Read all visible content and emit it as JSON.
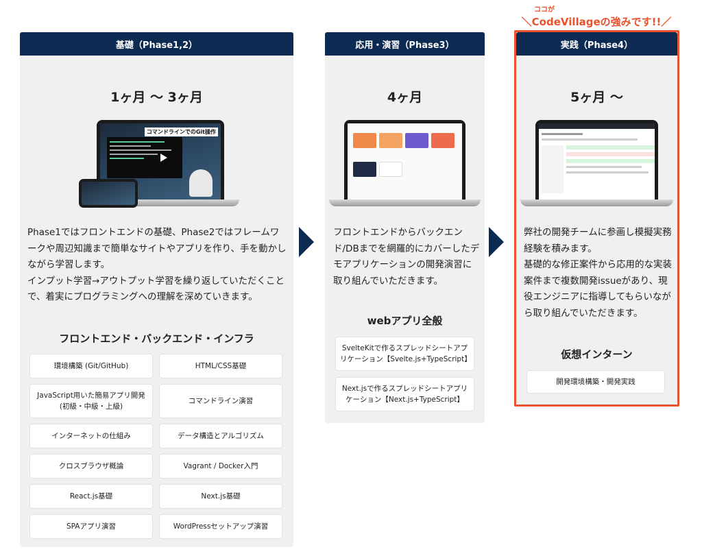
{
  "callout": {
    "small": "ココが",
    "big": "＼CodeVillageの強みです!!／"
  },
  "columns": [
    {
      "header": "基礎（Phase1,2）",
      "duration": "1ヶ月 〜 3ヶ月",
      "screen_caption": "コマンドラインでのGit操作",
      "description": "Phase1ではフロントエンドの基礎、Phase2ではフレームワークや周辺知識まで簡単なサイトやアプリを作り、手を動かしながら学習します。\nインプット学習→アウトプット学習を繰り返していただくことで、着実にプログラミングへの理解を深めていきます。",
      "section_title": "フロントエンド・バックエンド・インフラ",
      "items": [
        "環境構築 (Git/GitHub)",
        "HTML/CSS基礎",
        "JavaScript用いた簡易アプリ開発\n(初級・中級・上級)",
        "コマンドライン演習",
        "インターネットの仕組み",
        "データ構造とアルゴリズム",
        "クロスブラウザ概論",
        "Vagrant / Docker入門",
        "React.js基礎",
        "Next.js基礎",
        "SPAアプリ演習",
        "WordPressセットアップ演習"
      ]
    },
    {
      "header": "応用・演習（Phase3）",
      "duration": "4ヶ月",
      "description": "フロントエンドからバックエンド/DBまでを網羅的にカバーしたデモアプリケーションの開発演習に取り組んでいただきます。",
      "section_title": "webアプリ全般",
      "items": [
        "SvelteKitで作るスプレッドシートアプリケーション【Svelte.js+TypeScript】",
        "Next.jsで作るスプレッドシートアプリケーション【Next.js+TypeScript】"
      ]
    },
    {
      "header": "実践（Phase4）",
      "duration": "5ヶ月 〜",
      "description": "弊社の開発チームに参画し模擬実務経験を積みます。\n基礎的な修正案件から応用的な実装案件まで複数開発issueがあり、現役エンジニアに指導してもらいながら取り組んでいただきます。",
      "section_title": "仮想インターン",
      "items": [
        "開発環境構築・開発実践"
      ]
    }
  ],
  "colors": {
    "header_bg": "#0d2a52",
    "accent": "#e8522c",
    "panel_bg": "#f0f0f0"
  }
}
